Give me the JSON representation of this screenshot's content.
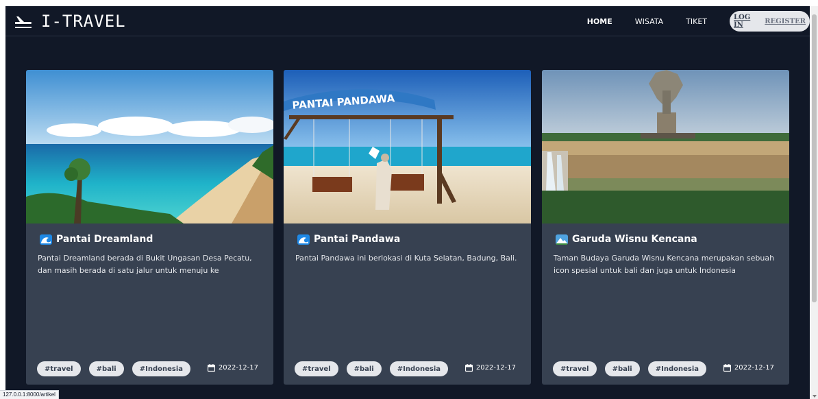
{
  "nav": {
    "brand": "I-TRAVEL",
    "brand_icon": "airplane-icon",
    "links": [
      "HOME",
      "WISATA",
      "TIKET"
    ],
    "login": "LOG IN",
    "register": "REGISTER"
  },
  "cards": [
    {
      "title": "Pantai Dreamland",
      "icon": "wave-emoji-icon",
      "description": "Pantai Dreamland berada di Bukit Ungasan Desa Pecatu, dan masih berada di satu jalur untuk menuju ke",
      "tags": [
        "#travel",
        "#bali",
        "#Indonesia"
      ],
      "date": "2022-12-17"
    },
    {
      "title": "Pantai Pandawa",
      "icon": "wave-emoji-icon",
      "image_sign": "PANTAI PANDAWA",
      "description": "Pantai Pandawa ini berlokasi di Kuta Selatan, Badung, Bali.",
      "tags": [
        "#travel",
        "#bali",
        "#Indonesia"
      ],
      "date": "2022-12-17"
    },
    {
      "title": "Garuda Wisnu Kencana",
      "icon": "mountain-emoji-icon",
      "description": "Taman Budaya Garuda Wisnu Kencana merupakan sebuah icon spesial untuk bali dan juga untuk Indonesia",
      "tags": [
        "#travel",
        "#bali",
        "#Indonesia"
      ],
      "date": "2022-12-17"
    }
  ],
  "status_url": "127.0.0.1:8000/artikel",
  "colors": {
    "page_bg": "#111827",
    "card_bg": "#374151",
    "tag_bg": "#e5e7eb",
    "text": "#ffffff"
  }
}
